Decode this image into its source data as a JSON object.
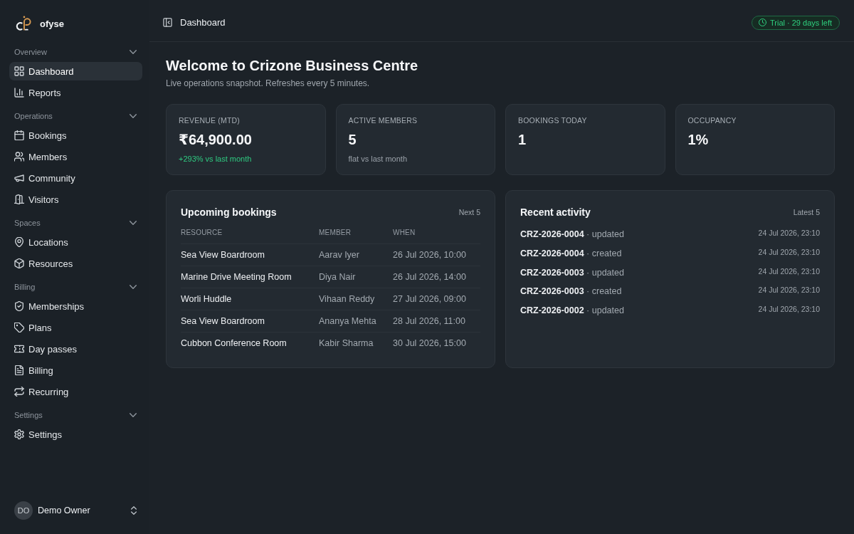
{
  "brand": {
    "name": "ofyse"
  },
  "sidebar": {
    "sections": [
      {
        "title": "Overview",
        "expanded": true,
        "items": [
          {
            "label": "Dashboard",
            "selected": true
          },
          {
            "label": "Reports",
            "selected": false
          }
        ]
      },
      {
        "title": "Operations",
        "expanded": true,
        "items": [
          {
            "label": "Bookings",
            "selected": false
          },
          {
            "label": "Members",
            "selected": false
          },
          {
            "label": "Community",
            "selected": false
          },
          {
            "label": "Visitors",
            "selected": false
          }
        ]
      },
      {
        "title": "Spaces",
        "expanded": true,
        "items": [
          {
            "label": "Locations",
            "selected": false
          },
          {
            "label": "Resources",
            "selected": false
          }
        ]
      },
      {
        "title": "Billing",
        "expanded": true,
        "items": [
          {
            "label": "Memberships",
            "selected": false
          },
          {
            "label": "Plans",
            "selected": false
          },
          {
            "label": "Day passes",
            "selected": false
          },
          {
            "label": "Billing",
            "selected": false
          },
          {
            "label": "Recurring",
            "selected": false
          }
        ]
      },
      {
        "title": "Settings",
        "expanded": true,
        "items": [
          {
            "label": "Settings",
            "selected": false
          }
        ]
      }
    ],
    "user": {
      "initials": "DO",
      "name": "Demo Owner"
    }
  },
  "header": {
    "title": "Dashboard",
    "trial_badge": "Trial · 29 days left"
  },
  "welcome": {
    "title": "Welcome to Crizone Business Centre",
    "subtitle": "Live operations snapshot. Refreshes every 5 minutes."
  },
  "stats": [
    {
      "label": "REVENUE (MTD)",
      "value": "₹64,900.00",
      "note": {
        "text": "+293% vs last month",
        "color": "#2fc980"
      }
    },
    {
      "label": "ACTIVE MEMBERS",
      "value": "5",
      "note": {
        "text": "flat vs last month",
        "color": "#9aa1a9"
      }
    },
    {
      "label": "BOOKINGS TODAY",
      "value": "1"
    },
    {
      "label": "OCCUPANCY",
      "value": "1%"
    }
  ],
  "upcoming_bookings": {
    "title": "Upcoming bookings",
    "count": "Next 5",
    "columns": [
      "RESOURCE",
      "MEMBER",
      "WHEN"
    ],
    "rows": [
      [
        "Sea View Boardroom",
        "Aarav Iyer",
        "26 Jul 2026, 10:00"
      ],
      [
        "Marine Drive Meeting Room",
        "Diya Nair",
        "26 Jul 2026, 14:00"
      ],
      [
        "Worli Huddle",
        "Vihaan Reddy",
        "27 Jul 2026, 09:00"
      ],
      [
        "Sea View Boardroom",
        "Ananya Mehta",
        "28 Jul 2026, 11:00"
      ],
      [
        "Cubbon Conference Room",
        "Kabir Sharma",
        "30 Jul 2026, 15:00"
      ]
    ]
  },
  "recent_activity": {
    "title": "Recent activity",
    "count": "Latest 5",
    "items": [
      {
        "text": "**CRZ-2026-0004** · updated",
        "time": "24 Jul 2026, 23:10"
      },
      {
        "text": "**CRZ-2026-0004** · created",
        "time": "24 Jul 2026, 23:10"
      },
      {
        "text": "**CRZ-2026-0003** · updated",
        "time": "24 Jul 2026, 23:10"
      },
      {
        "text": "**CRZ-2026-0003** · created",
        "time": "24 Jul 2026, 23:10"
      },
      {
        "text": "**CRZ-2026-0002** · updated",
        "time": "24 Jul 2026, 23:10"
      }
    ]
  }
}
